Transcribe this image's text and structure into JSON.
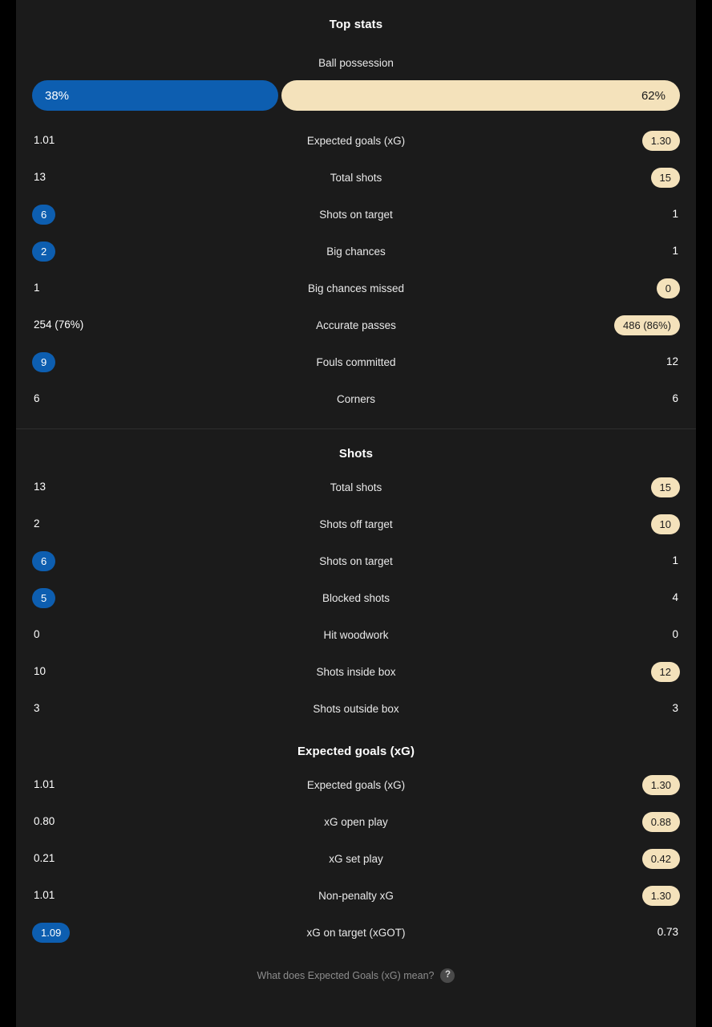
{
  "colors": {
    "home_accent": "#0d5eb0",
    "away_accent": "#f4e2bb",
    "panel_bg": "#1b1b1b",
    "page_bg": "#000000"
  },
  "sections": [
    {
      "title": "Top stats",
      "possession": {
        "label": "Ball possession",
        "home_value": "38%",
        "away_value": "62%",
        "home_pct": 38,
        "away_pct": 62
      },
      "rows": [
        {
          "label": "Expected goals (xG)",
          "home": "1.01",
          "away": "1.30",
          "home_hl": false,
          "away_hl": true
        },
        {
          "label": "Total shots",
          "home": "13",
          "away": "15",
          "home_hl": false,
          "away_hl": true
        },
        {
          "label": "Shots on target",
          "home": "6",
          "away": "1",
          "home_hl": true,
          "away_hl": false
        },
        {
          "label": "Big chances",
          "home": "2",
          "away": "1",
          "home_hl": true,
          "away_hl": false
        },
        {
          "label": "Big chances missed",
          "home": "1",
          "away": "0",
          "home_hl": false,
          "away_hl": true
        },
        {
          "label": "Accurate passes",
          "home": "254 (76%)",
          "away": "486 (86%)",
          "home_hl": false,
          "away_hl": true
        },
        {
          "label": "Fouls committed",
          "home": "9",
          "away": "12",
          "home_hl": true,
          "away_hl": false
        },
        {
          "label": "Corners",
          "home": "6",
          "away": "6",
          "home_hl": false,
          "away_hl": false
        }
      ],
      "divider_after": true
    },
    {
      "title": "Shots",
      "rows": [
        {
          "label": "Total shots",
          "home": "13",
          "away": "15",
          "home_hl": false,
          "away_hl": true
        },
        {
          "label": "Shots off target",
          "home": "2",
          "away": "10",
          "home_hl": false,
          "away_hl": true
        },
        {
          "label": "Shots on target",
          "home": "6",
          "away": "1",
          "home_hl": true,
          "away_hl": false
        },
        {
          "label": "Blocked shots",
          "home": "5",
          "away": "4",
          "home_hl": true,
          "away_hl": false
        },
        {
          "label": "Hit woodwork",
          "home": "0",
          "away": "0",
          "home_hl": false,
          "away_hl": false
        },
        {
          "label": "Shots inside box",
          "home": "10",
          "away": "12",
          "home_hl": false,
          "away_hl": true
        },
        {
          "label": "Shots outside box",
          "home": "3",
          "away": "3",
          "home_hl": false,
          "away_hl": false
        }
      ],
      "divider_after": false
    },
    {
      "title": "Expected goals (xG)",
      "rows": [
        {
          "label": "Expected goals (xG)",
          "home": "1.01",
          "away": "1.30",
          "home_hl": false,
          "away_hl": true
        },
        {
          "label": "xG open play",
          "home": "0.80",
          "away": "0.88",
          "home_hl": false,
          "away_hl": true
        },
        {
          "label": "xG set play",
          "home": "0.21",
          "away": "0.42",
          "home_hl": false,
          "away_hl": true
        },
        {
          "label": "Non-penalty xG",
          "home": "1.01",
          "away": "1.30",
          "home_hl": false,
          "away_hl": true
        },
        {
          "label": "xG on target (xGOT)",
          "home": "1.09",
          "away": "0.73",
          "home_hl": true,
          "away_hl": false
        }
      ],
      "divider_after": false
    }
  ],
  "footer": {
    "text": "What does Expected Goals (xG) mean?",
    "icon": "help-question-icon",
    "icon_glyph": "?"
  }
}
